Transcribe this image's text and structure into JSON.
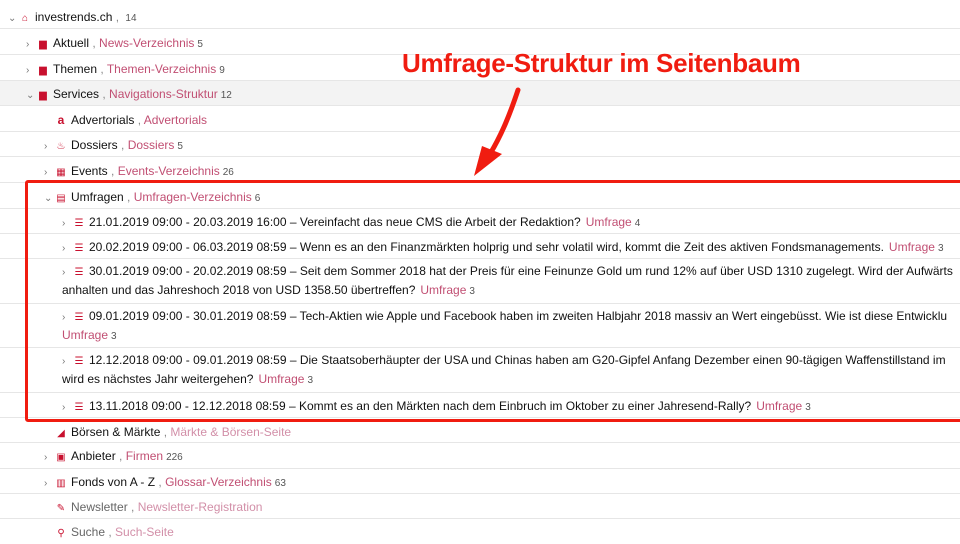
{
  "annotation": {
    "label": "Umfrage-Struktur im Seitenbaum",
    "color": "#f01c10"
  },
  "colors": {
    "accent": "#c8102e",
    "type_link": "#c14f73",
    "highlight_border": "#f01c10"
  },
  "tree": {
    "root": {
      "title": "investrends.ch",
      "count": "14",
      "icon": "home-icon"
    },
    "items": [
      {
        "title": "Aktuell",
        "type": "News-Verzeichnis",
        "count": "5",
        "icon": "folder-icon"
      },
      {
        "title": "Themen",
        "type": "Themen-Verzeichnis",
        "count": "9",
        "icon": "folder-icon"
      },
      {
        "title": "Services",
        "type": "Navigations-Struktur",
        "count": "12",
        "icon": "folder-icon"
      },
      {
        "title": "Advertorials",
        "type": "Advertorials",
        "count": "",
        "icon": "amazon-icon"
      },
      {
        "title": "Dossiers",
        "type": "Dossiers",
        "count": "5",
        "icon": "dossier-icon"
      },
      {
        "title": "Events",
        "type": "Events-Verzeichnis",
        "count": "26",
        "icon": "calendar-icon"
      },
      {
        "title": "Umfragen",
        "type": "Umfragen-Verzeichnis",
        "count": "6",
        "icon": "poll-list-icon"
      },
      {
        "title": "Börsen & Märkte",
        "type": "Märkte & Börsen-Seite",
        "count": "",
        "icon": "chart-icon"
      },
      {
        "title": "Anbieter",
        "type": "Firmen",
        "count": "226",
        "icon": "id-card-icon"
      },
      {
        "title": "Fonds von A - Z",
        "type": "Glossar-Verzeichnis",
        "count": "63",
        "icon": "book-icon"
      },
      {
        "title": "Newsletter",
        "type": "Newsletter-Registration",
        "count": "",
        "icon": "edit-icon"
      },
      {
        "title": "Suche",
        "type": "Such-Seite",
        "count": "",
        "icon": "search-icon"
      }
    ],
    "polls": [
      {
        "line1": "21.01.2019 09:00 - 20.03.2019 16:00 – Vereinfacht das neue CMS die Arbeit der Redaktion?",
        "line2": "",
        "type": "Umfrage",
        "count": "4"
      },
      {
        "line1": "20.02.2019 09:00 - 06.03.2019 08:59 – Wenn es an den Finanzmärkten holprig und sehr volatil wird, kommt die Zeit des aktiven Fondsmanagements.",
        "line2": "",
        "type": "Umfrage",
        "count": "3"
      },
      {
        "line1": "30.01.2019 09:00 - 20.02.2019 08:59 – Seit dem Sommer 2018 hat der Preis für eine Feinunze Gold um rund 12% auf über USD 1310 zugelegt. Wird der Aufwärts",
        "line2": "anhalten und das Jahreshoch 2018 von USD 1358.50 übertreffen?",
        "type": "Umfrage",
        "count": "3"
      },
      {
        "line1": "09.01.2019 09:00 - 30.01.2019 08:59 – Tech-Aktien wie Apple und Facebook haben im zweiten Halbjahr 2018 massiv an Wert eingebüsst. Wie ist diese Entwicklu",
        "line2": "",
        "type": "Umfrage",
        "count": "3"
      },
      {
        "line1": "12.12.2018 09:00 - 09.01.2019 08:59 – Die Staatsoberhäupter der USA und Chinas haben am G20-Gipfel Anfang Dezember einen 90-tägigen Waffenstillstand im",
        "line2": "wird es nächstes Jahr weitergehen?",
        "type": "Umfrage",
        "count": "3"
      },
      {
        "line1": "13.11.2018 09:00 - 12.12.2018 08:59 – Kommt es an den Märkten nach dem Einbruch im Oktober zu einer Jahresend-Rally?",
        "line2": "",
        "type": "Umfrage",
        "count": "3"
      }
    ]
  }
}
